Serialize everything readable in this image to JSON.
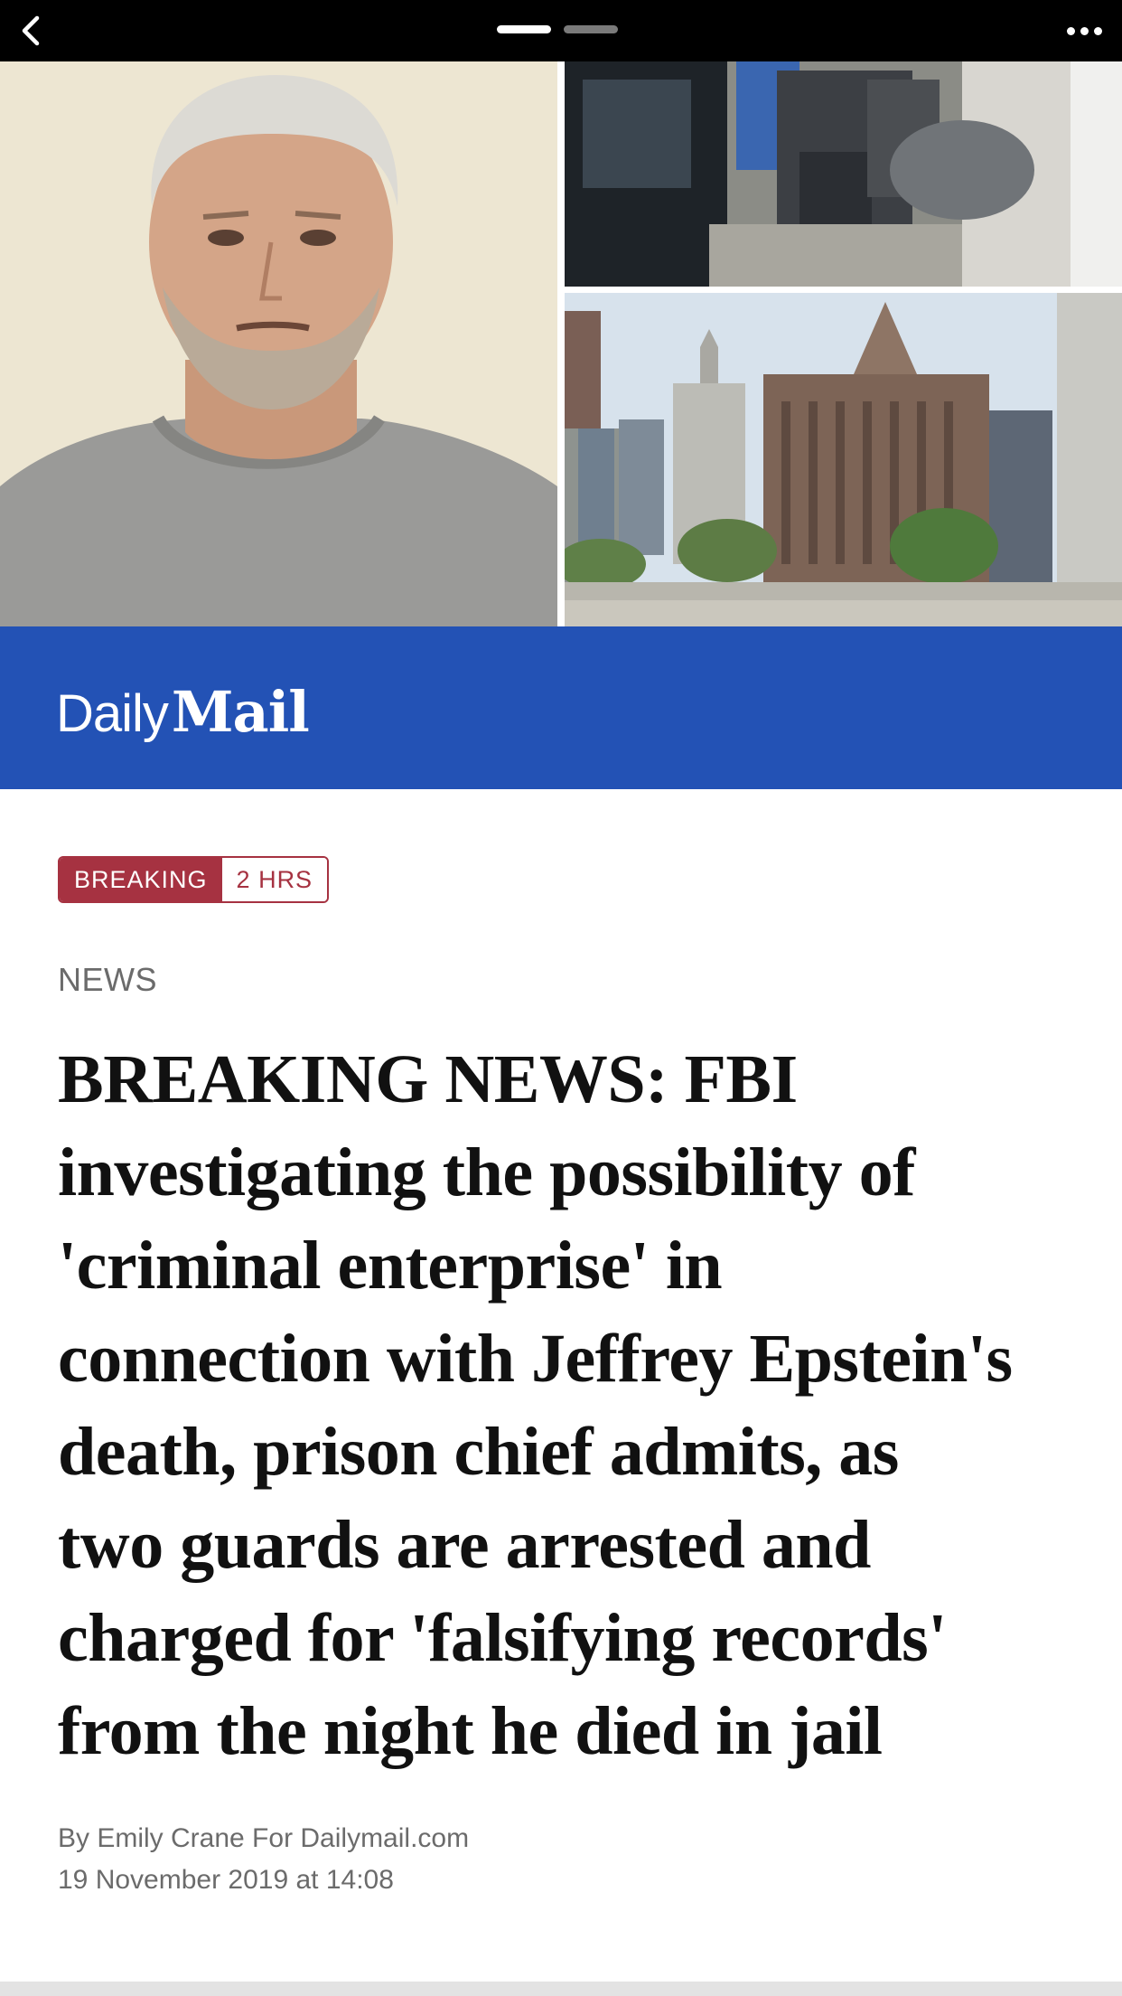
{
  "nav": {
    "back_icon": "chevron-left-icon",
    "more_icon": "ellipsis-icon",
    "pages": [
      {
        "active": true
      },
      {
        "active": false
      }
    ]
  },
  "hero": {
    "photos": [
      {
        "name": "portrait-photo"
      },
      {
        "name": "guards-photo"
      },
      {
        "name": "prison-building-photo"
      }
    ]
  },
  "publisher": {
    "logo_daily": "Daily",
    "logo_mail": "Mail",
    "band_color": "#2352b5"
  },
  "article": {
    "badge_label": "BREAKING",
    "badge_time": "2 HRS",
    "badge_color": "#a63241",
    "category": "NEWS",
    "headline_lines": [
      "BREAKING NEWS: FBI",
      "investigating the possibility of",
      "'criminal enterprise' in",
      "connection with Jeffrey Epstein's",
      "death, prison chief admits, as",
      "two guards are arrested and",
      "charged for 'falsifying records'",
      "from the night he died in jail"
    ],
    "byline": "By Emily Crane For Dailymail.com",
    "date": "19 November 2019 at 14:08"
  }
}
